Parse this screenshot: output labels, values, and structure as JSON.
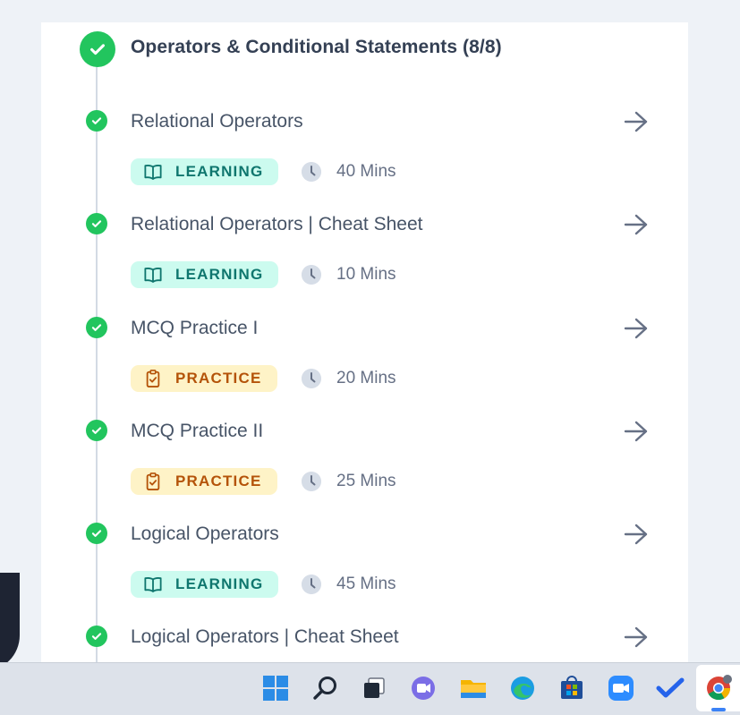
{
  "section": {
    "title": "Operators & Conditional Statements (8/8)"
  },
  "items": [
    {
      "title": "Relational Operators",
      "badge": "LEARNING",
      "badge_type": "learning",
      "duration": "40 Mins"
    },
    {
      "title": "Relational Operators | Cheat Sheet",
      "badge": "LEARNING",
      "badge_type": "learning",
      "duration": "10 Mins"
    },
    {
      "title": "MCQ Practice I",
      "badge": "PRACTICE",
      "badge_type": "practice",
      "duration": "20 Mins"
    },
    {
      "title": "MCQ Practice II",
      "badge": "PRACTICE",
      "badge_type": "practice",
      "duration": "25 Mins"
    },
    {
      "title": "Logical Operators",
      "badge": "LEARNING",
      "badge_type": "learning",
      "duration": "45 Mins"
    },
    {
      "title": "Logical Operators | Cheat Sheet"
    }
  ],
  "colors": {
    "complete_green": "#22c55e",
    "learning_bg": "#ccfbef",
    "learning_text": "#0f766e",
    "practice_bg": "#fef3c7",
    "practice_text": "#b45309"
  },
  "icons": {
    "item_status": "check-circle-icon",
    "item_open": "arrow-right-icon",
    "learning": "book-open-icon",
    "practice": "clipboard-check-icon",
    "duration": "clock-icon"
  },
  "taskbar": {
    "apps": [
      "windows-start",
      "search",
      "task-view",
      "teams-chat",
      "file-explorer",
      "edge",
      "microsoft-store",
      "zoom",
      "todo",
      "chrome"
    ]
  }
}
